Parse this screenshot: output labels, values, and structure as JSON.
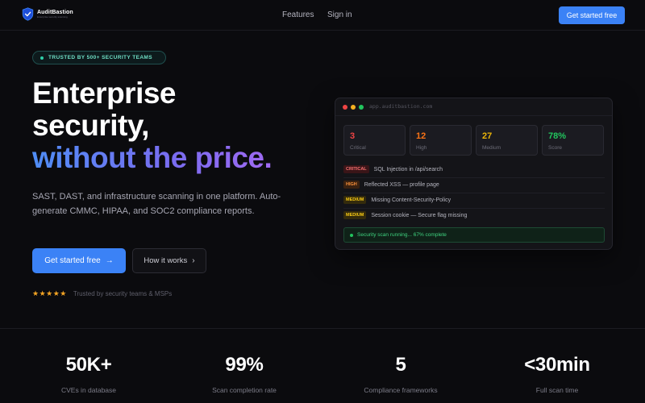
{
  "nav": {
    "logo_name": "AuditBastion",
    "logo_tagline": "Enterprise security scanning",
    "links": [
      "Features",
      "Sign in"
    ],
    "cta": "Get started free"
  },
  "hero": {
    "badge": "TRUSTED BY 500+ SECURITY TEAMS",
    "headline_1": "Enterprise",
    "headline_2": "security,",
    "headline_3": "without the price.",
    "subtext": "SAST, DAST, and infrastructure scanning in one platform. Auto-generate CMMC, HIPAA, and SOC2 compliance reports.",
    "primary_button": "Get started free",
    "secondary_button": "How it works",
    "stars": "★★★★★",
    "trust_text": "Trusted by security teams & MSPs"
  },
  "app_window": {
    "url": "app.auditbastion.com",
    "stats": [
      {
        "value": "3",
        "label": "Critical",
        "color": "#ef4444"
      },
      {
        "value": "12",
        "label": "High",
        "color": "#f97316"
      },
      {
        "value": "27",
        "label": "Medium",
        "color": "#eab308"
      },
      {
        "value": "78%",
        "label": "Score",
        "color": "#22c55e"
      }
    ],
    "findings": [
      {
        "severity": "CRITICAL",
        "text": "SQL Injection in /api/search",
        "fg": "#f87171",
        "bg": "#3a1518"
      },
      {
        "severity": "HIGH",
        "text": "Reflected XSS — profile page",
        "fg": "#fb923c",
        "bg": "#3a2110"
      },
      {
        "severity": "MEDIUM",
        "text": "Missing Content-Security-Policy",
        "fg": "#facc15",
        "bg": "#342b0c"
      },
      {
        "severity": "MEDIUM",
        "text": "Session cookie — Secure flag missing",
        "fg": "#facc15",
        "bg": "#342b0c"
      }
    ],
    "status": "Security scan running... 67% complete",
    "scan_progress": 0.67
  },
  "metrics": [
    {
      "value": "50K+",
      "label": "CVEs in database"
    },
    {
      "value": "99%",
      "label": "Scan completion rate"
    },
    {
      "value": "5",
      "label": "Compliance frameworks"
    },
    {
      "value": "<30min",
      "label": "Full scan time"
    }
  ],
  "colors": {
    "accent": "#3b82f6",
    "background": "#0b0b0e"
  }
}
